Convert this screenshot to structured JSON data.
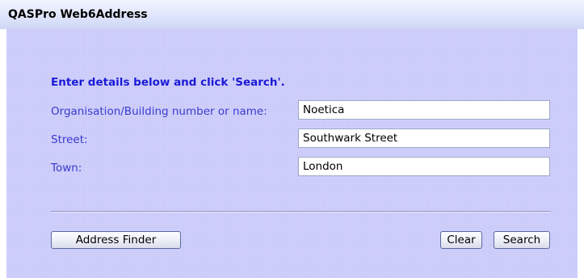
{
  "window": {
    "title": "QASPro Web6Address"
  },
  "form": {
    "instruction": "Enter details below and click 'Search'.",
    "fields": [
      {
        "label": "Organisation/Building number or name:",
        "value": "Noetica"
      },
      {
        "label": "Street:",
        "value": "Southwark Street"
      },
      {
        "label": "Town:",
        "value": "London"
      }
    ]
  },
  "buttons": {
    "address_finder": "Address Finder",
    "clear": "Clear",
    "search": "Search"
  },
  "colors": {
    "panel_background": "#c8c8fa",
    "label_text": "#3a3ad0",
    "heading_text": "#1a1ad6"
  }
}
